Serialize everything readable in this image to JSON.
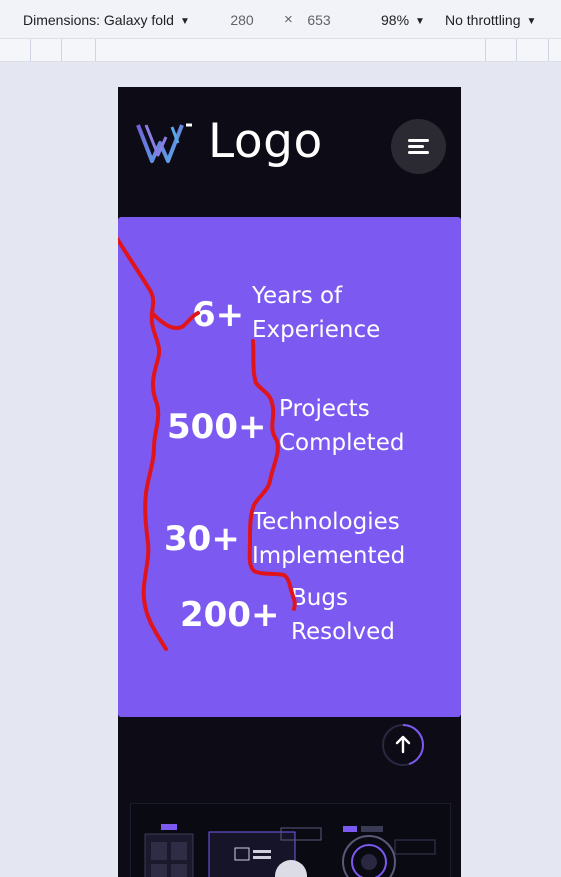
{
  "devtools": {
    "dimensions_label": "Dimensions: Galaxy fold",
    "width": "280",
    "height": "653",
    "zoom": "98%",
    "throttling": "No throttling"
  },
  "header": {
    "logo_text": "Logo",
    "menu_icon": "hamburger-menu-icon"
  },
  "stats": [
    {
      "number": "6+",
      "label_line1": "Years of",
      "label_line2": "Experience"
    },
    {
      "number": "500+",
      "label_line1": "Projects",
      "label_line2": "Completed"
    },
    {
      "number": "30+",
      "label_line1": "Technologies",
      "label_line2": "Implemented"
    },
    {
      "number": "200+",
      "label_line1": "Bugs",
      "label_line2": "Resolved"
    }
  ],
  "scroll_top": {
    "icon": "arrow-up-icon",
    "progress": 0.45
  },
  "colors": {
    "card_bg": "#7c5af1",
    "page_bg": "#0d0c16",
    "annotation": "#e0141b",
    "accent": "#7c5af1"
  }
}
